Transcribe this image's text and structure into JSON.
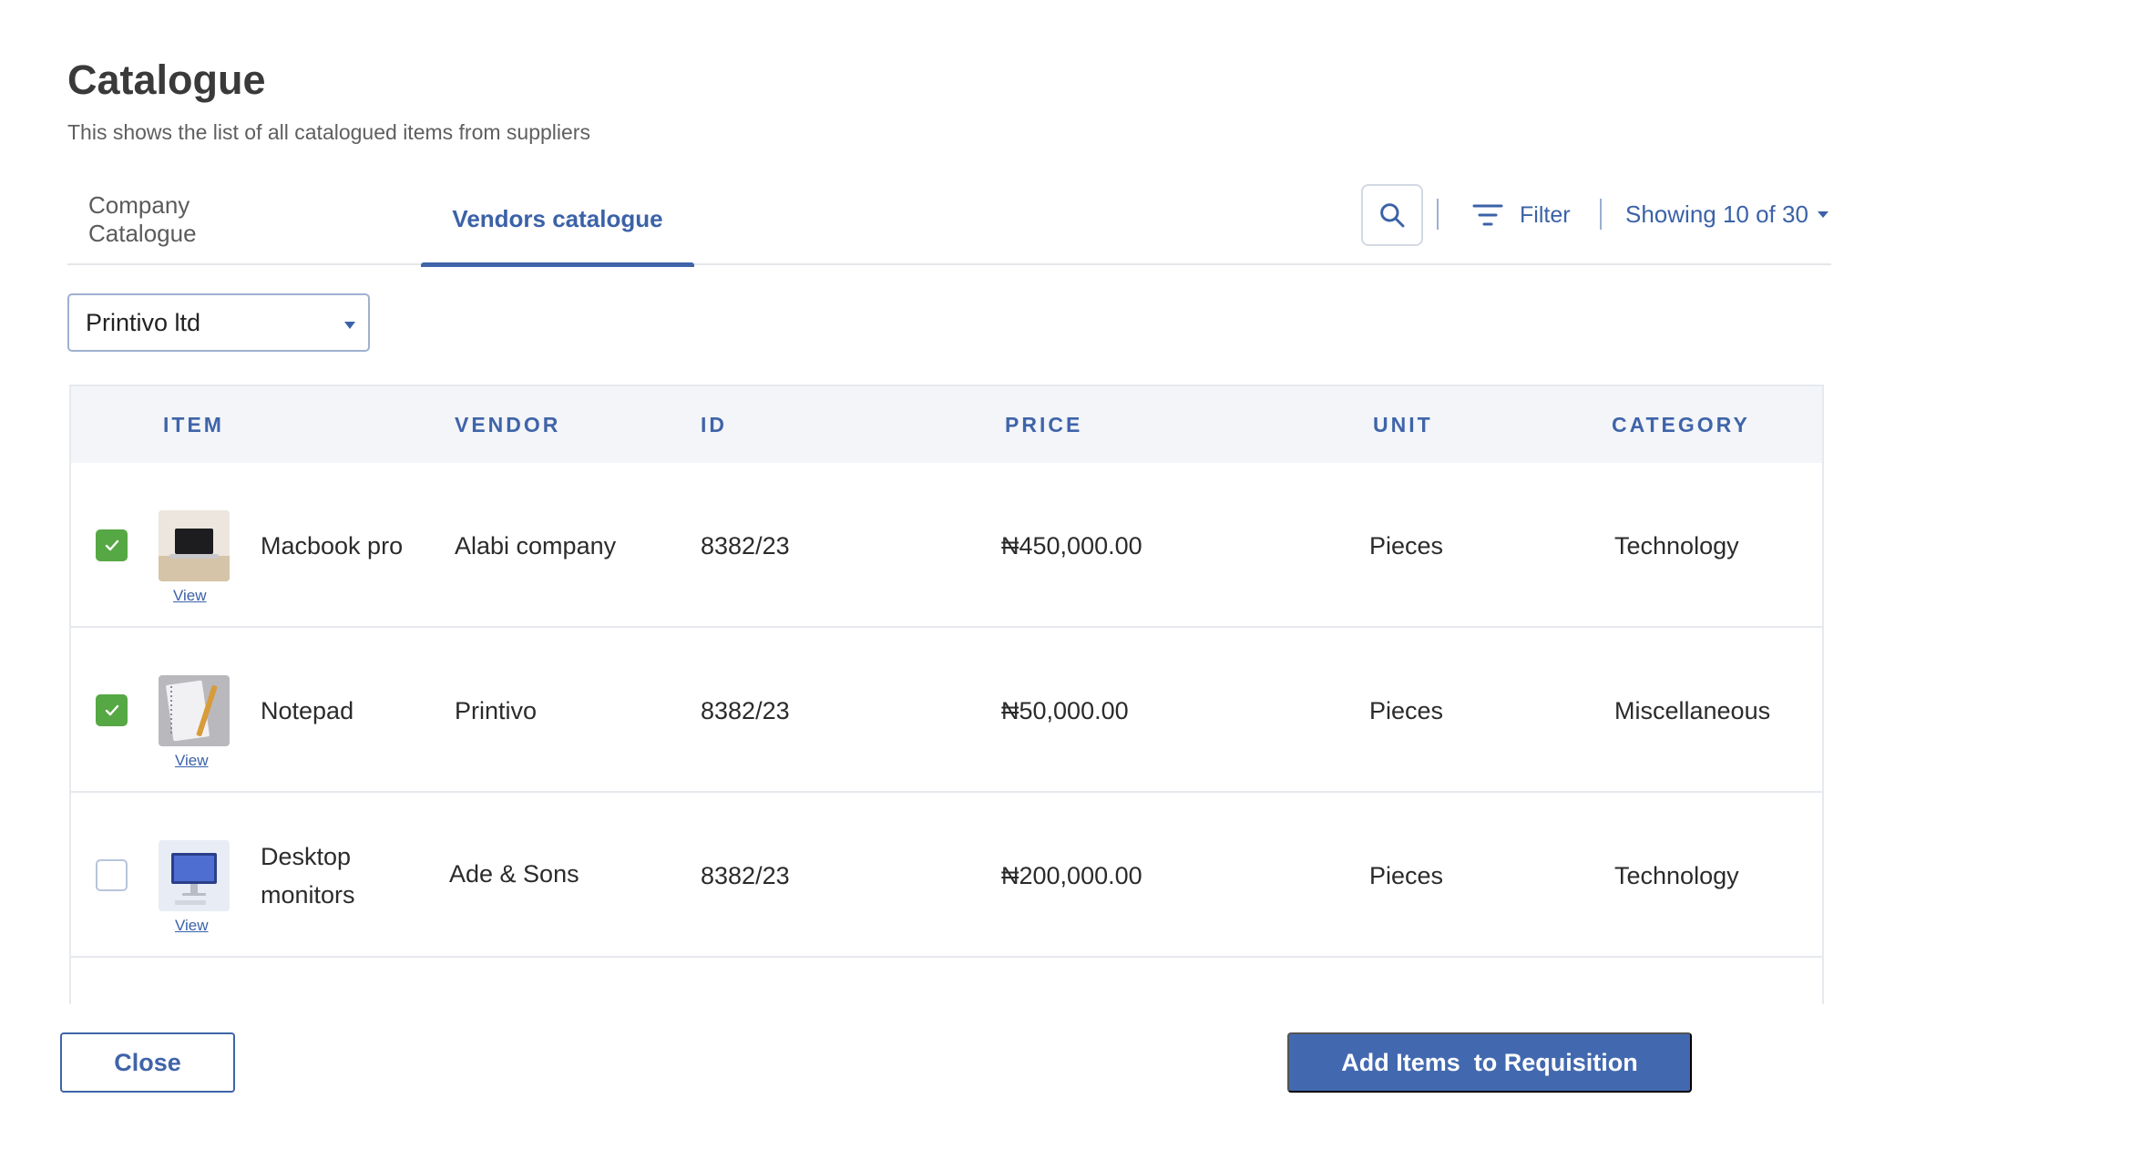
{
  "header": {
    "title": "Catalogue",
    "subtitle": "This shows the list of all catalogued items from suppliers"
  },
  "tabs": [
    {
      "label": "Company Catalogue",
      "active": false
    },
    {
      "label": "Vendors catalogue",
      "active": true
    }
  ],
  "toolbar": {
    "search_icon": "search-icon",
    "filter_label": "Filter",
    "filter_icon": "filter-lines-icon",
    "showing_label": "Showing 10 of 30"
  },
  "vendor_select": {
    "value": "Printivo ltd"
  },
  "table": {
    "columns": [
      "ITEM",
      "VENDOR",
      "ID",
      "PRICE",
      "UNIT",
      "CATEGORY"
    ],
    "rows": [
      {
        "checked": true,
        "thumb": "laptop",
        "view": "View",
        "item": "Macbook pro",
        "vendor": "Alabi company",
        "id": "8382/23",
        "price": "₦450,000.00",
        "unit": "Pieces",
        "category": "Technology"
      },
      {
        "checked": true,
        "thumb": "notepad",
        "view": "View",
        "item": "Notepad",
        "vendor": "Printivo",
        "id": "8382/23",
        "price": "₦50,000.00",
        "unit": "Pieces",
        "category": "Miscellaneous"
      },
      {
        "checked": false,
        "thumb": "monitor",
        "view": "View",
        "item": "Desktop monitors",
        "vendor": "Ade & Sons",
        "id": "8382/23",
        "price": "₦200,000.00",
        "unit": "Pieces",
        "category": "Technology"
      }
    ]
  },
  "footer": {
    "close_label": "Close",
    "add_label": "Add Items  to Requisition"
  },
  "colors": {
    "accent": "#3f64a9",
    "check": "#56a844",
    "header_bg": "#f3f5f9"
  }
}
